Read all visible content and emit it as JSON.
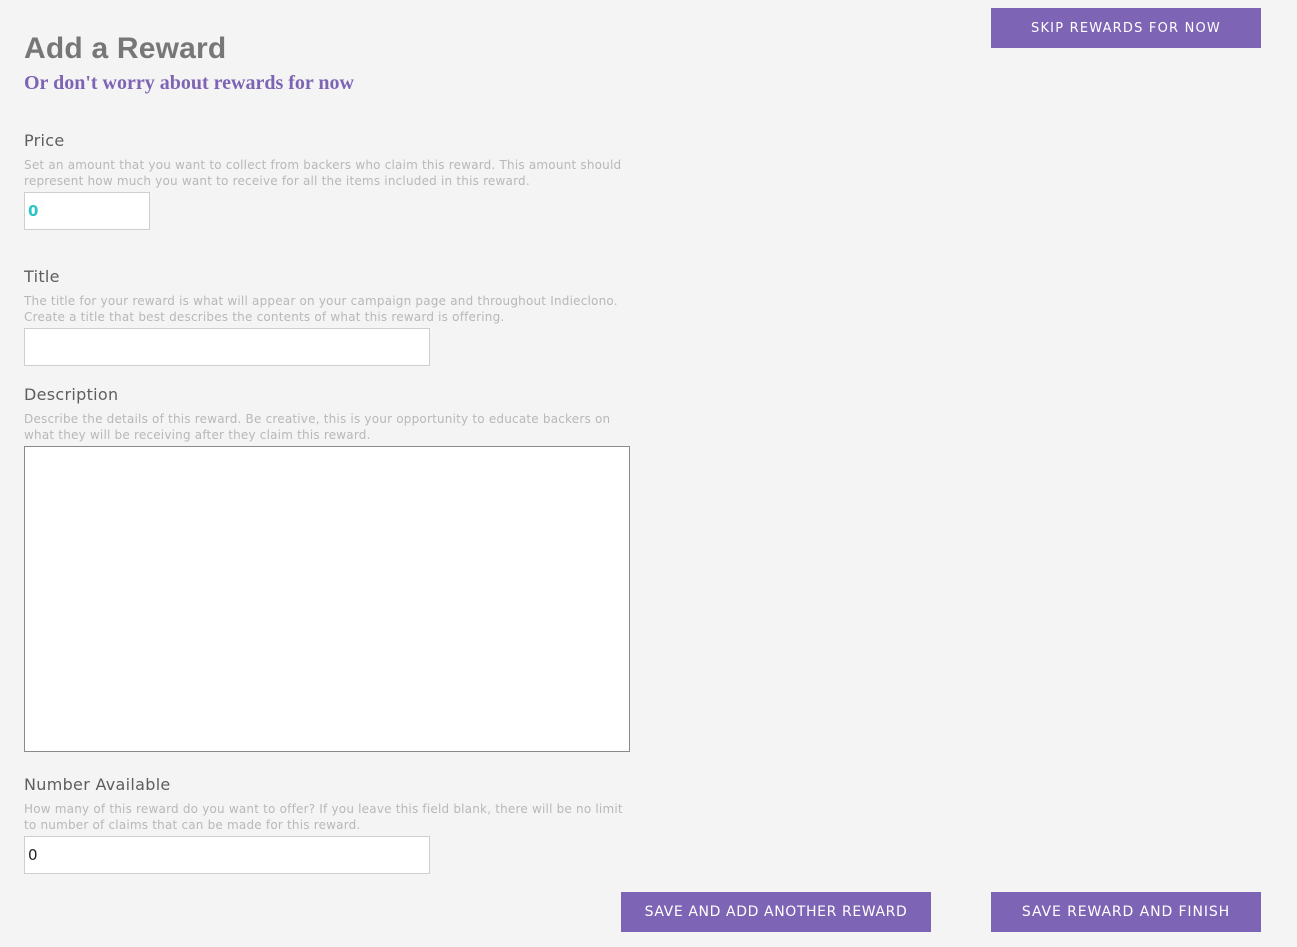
{
  "header": {
    "title": "Add a Reward",
    "subtitle": "Or don't worry about rewards for now",
    "skip_label": "SKIP REWARDS FOR NOW"
  },
  "fields": {
    "price": {
      "label": "Price",
      "help": "Set an amount that you want to collect from backers who claim this reward. This amount should represent how much you want to receive for all the items included in this reward.",
      "value": "0"
    },
    "title": {
      "label": "Title",
      "help": "The title for your reward is what will appear on your campaign page and throughout Indieclono. Create a title that best describes the contents of what this reward is offering.",
      "value": ""
    },
    "description": {
      "label": "Description",
      "help": "Describe the details of this reward. Be creative, this is your opportunity to educate backers on what they will be receiving after they claim this reward.",
      "value": ""
    },
    "number_available": {
      "label": "Number Available",
      "help": "How many of this reward do you want to offer? If you leave this field blank, there will be no limit to number of claims that can be made for this reward.",
      "value": "0"
    }
  },
  "actions": {
    "save_add_label": "SAVE AND ADD ANOTHER REWARD",
    "save_finish_label": "SAVE REWARD AND FINISH"
  },
  "colors": {
    "accent": "#7e64b4",
    "price_value": "#2ec4c6",
    "background": "#f4f4f4"
  }
}
